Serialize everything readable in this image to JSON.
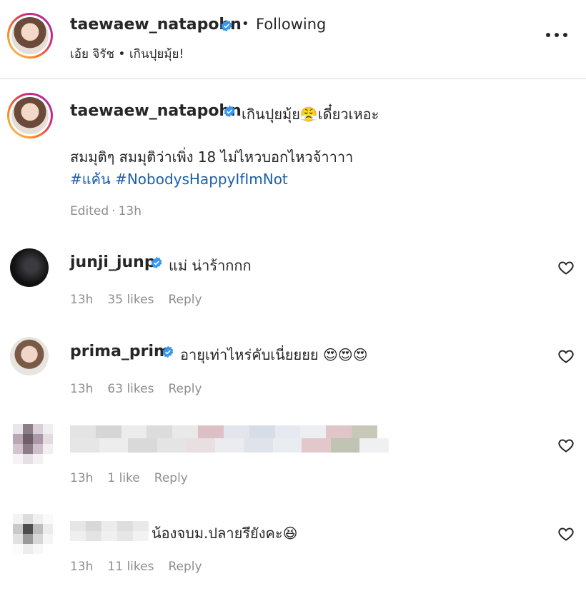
{
  "header": {
    "username": "taewaew_natapohn",
    "separator": "•",
    "following_label": "Following",
    "subtitle": "เอ้ย จิรัช • เกินปุยมุ้ย!",
    "more_icon": "more-horizontal-icon"
  },
  "caption": {
    "username": "taewaew_natapohn",
    "text_line1": "เกินปุยมุ้ย😤เดี๋ยวเหอะ",
    "text_line2": "สมมุติๆ สมมุติว่าเพิ่ง 18 ไม่ไหวบอกไหวจ้าาาา",
    "hashtags": "#แค้น #NobodysHappyIfImNot",
    "edited_label": "Edited",
    "time": "13h"
  },
  "comments": [
    {
      "username": "junji_junp",
      "text": "แม่ น่าร้ากกก",
      "time": "13h",
      "likes": "35 likes",
      "reply": "Reply"
    },
    {
      "username": "prima_prim",
      "text": "อายุเท่าไหร่คับเนี่ยยยย 😍😍😍",
      "time": "13h",
      "likes": "63 likes",
      "reply": "Reply"
    },
    {
      "username": "",
      "text": "",
      "time": "13h",
      "likes": "1 like",
      "reply": "Reply"
    },
    {
      "username": "",
      "text": "น้องจบม.ปลายรึยังคะ😆",
      "time": "13h",
      "likes": "11 likes",
      "reply": "Reply"
    }
  ],
  "colors": {
    "verified": "#3897f0",
    "hashtag": "#1b5fa8",
    "meta": "#8e8e8e"
  }
}
